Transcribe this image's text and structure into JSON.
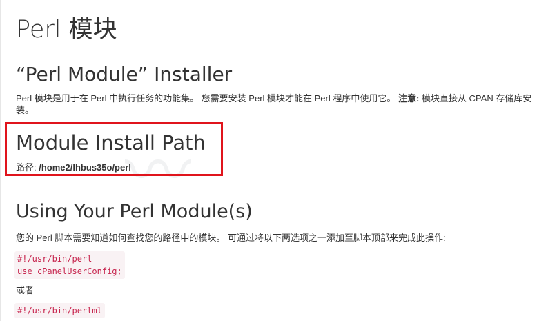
{
  "page": {
    "title": "Perl 模块"
  },
  "installer": {
    "heading": "“Perl Module” Installer",
    "description_part1": "Perl 模块是用于在 Perl 中执行任务的功能集。 您需要安装 Perl 模块才能在 Perl 程序中使用它。 ",
    "description_note_label": "注意:",
    "description_part2": " 模块直接从 CPAN 存储库安装。"
  },
  "install_path": {
    "heading": "Module Install Path",
    "label": "路径:",
    "value": "/home2/lhbus35o/perl"
  },
  "using": {
    "heading": "Using Your Perl Module(s)",
    "description": "您的 Perl 脚本需要知道如何查找您的路径中的模块。 可通过将以下两选项之一添加至脚本顶部来完成此操作:",
    "code1_line1": "#!/usr/bin/perl",
    "code1_line2": "use cPanelUserConfig;",
    "or_text": "或者",
    "code2_line1": "#!/usr/bin/perlml"
  },
  "colors": {
    "highlight_border": "#e0141c",
    "code_bg": "#f9f2f4",
    "code_text": "#c7254e"
  }
}
